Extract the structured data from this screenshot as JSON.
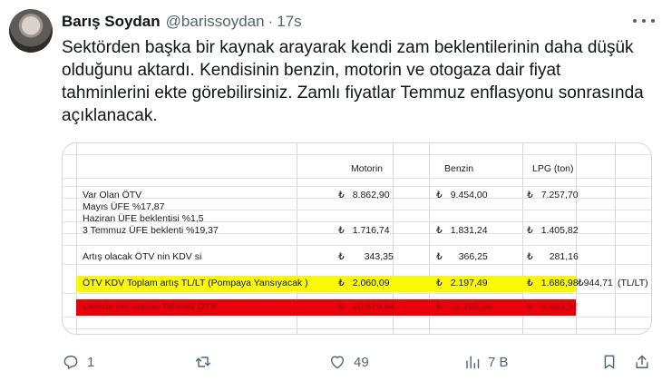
{
  "tweet": {
    "author_name": "Barış Soydan",
    "handle": "@barissoydan",
    "separator": "·",
    "time": "17s",
    "text": "Sektörden başka bir kaynak arayarak kendi zam beklentilerinin daha düşük olduğunu aktardı. Kendisinin benzin, motorin ve otogaza dair fiyat tahminlerini ekte görebilirsiniz. Zamlı fiyatlar Temmuz enflasyonu sonrasında açıklanacak."
  },
  "sheet": {
    "columns": [
      "Motorin",
      "Benzin",
      "LPG (ton)"
    ],
    "currency": "₺",
    "rows": {
      "var_olan": {
        "label": "Var Olan ÖTV",
        "values": [
          "8.862,90",
          "9.454,00",
          "7.257,70"
        ]
      },
      "mayis": {
        "label": "Mayıs ÜFE %17,87"
      },
      "haziran": {
        "label": "Haziran ÜFE beklentisi %1,5"
      },
      "temmuz": {
        "label": "3 Temmuz ÜFE beklenti %19,37",
        "values": [
          "1.716,74",
          "1.831,24",
          "1.405,82"
        ]
      },
      "artis": {
        "label": "Artış olacak ÖTV nin KDV si",
        "values": [
          "343,35",
          "366,25",
          "281,16"
        ]
      },
      "toplam": {
        "label": "ÖTV KDV Toplam artış TL/LT (Pompaya Yansıyacak )",
        "values": [
          "2.060,09",
          "2.197,49",
          "1.686,98"
        ],
        "extra": "₺944,71",
        "extra_unit": "(TL/LT)"
      },
      "tahmini": {
        "label": "Listede yer alacak Tahmini ÖTV",
        "values": [
          "10.579,64",
          "11.285,24",
          "8.663,52"
        ]
      }
    }
  },
  "actions": {
    "replies": "1",
    "retweets": "",
    "likes": "49",
    "views": "7 B"
  },
  "icons": {
    "more": "more-horizontal-icon",
    "reply": "reply-icon",
    "retweet": "retweet-icon",
    "like": "heart-icon",
    "views": "views-chart-icon",
    "bookmark": "bookmark-icon",
    "share": "share-icon"
  },
  "colors": {
    "highlight_yellow": "#f9f900",
    "highlight_red": "#e8000b",
    "secondary_text": "#536471"
  }
}
